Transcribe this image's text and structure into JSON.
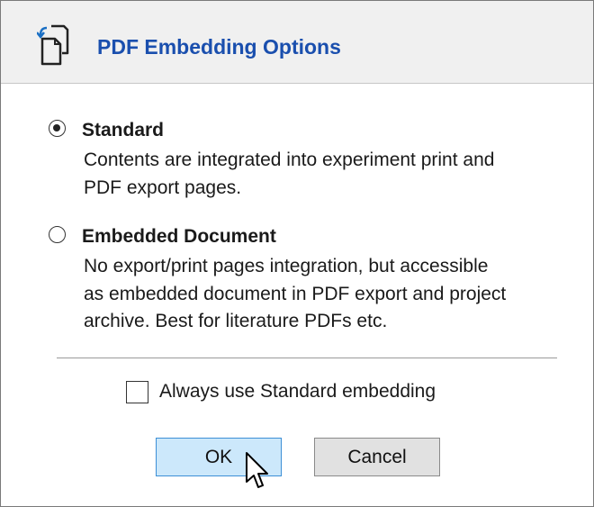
{
  "dialog": {
    "title": "PDF Embedding Options",
    "icon": "pdf-embed-icon"
  },
  "options": [
    {
      "label": "Standard",
      "selected": true,
      "description_lines": [
        "Contents are integrated into experiment print and",
        "PDF export pages."
      ]
    },
    {
      "label": "Embedded Document",
      "selected": false,
      "description_lines": [
        "No export/print pages integration, but accessible",
        "as embedded document in PDF export and project",
        "archive. Best for literature PDFs etc."
      ]
    }
  ],
  "checkbox": {
    "label": "Always use Standard embedding",
    "checked": false
  },
  "buttons": {
    "ok_label": "OK",
    "cancel_label": "Cancel"
  },
  "colors": {
    "title": "#1a4fae",
    "ok_bg": "#cce8fb",
    "ok_border": "#3d8fd6",
    "header_bg": "#f0f0f0"
  }
}
